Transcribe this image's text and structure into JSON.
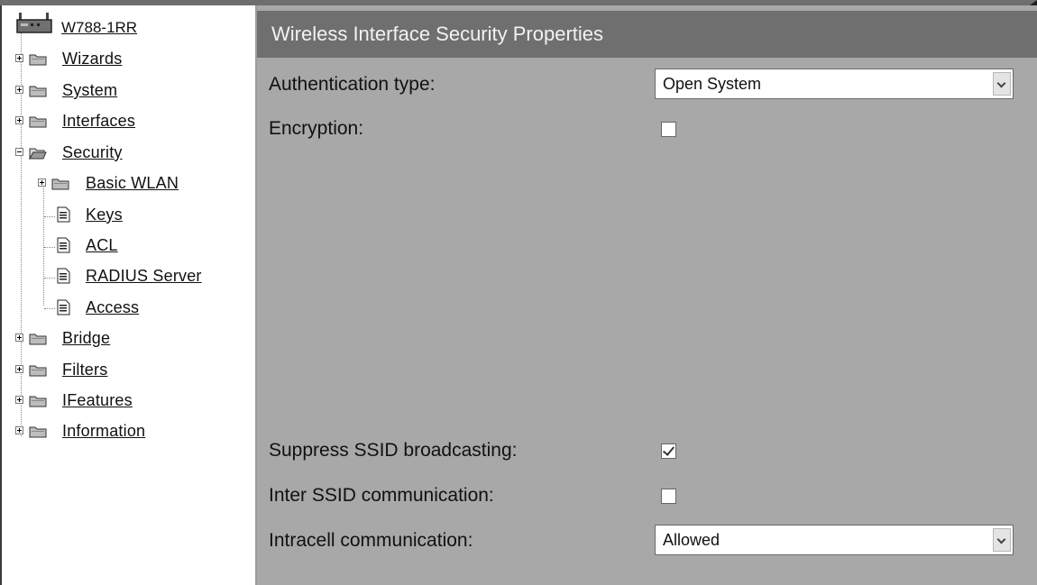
{
  "tree": {
    "root": "W788-1RR",
    "items": [
      {
        "label": "Wizards"
      },
      {
        "label": "System"
      },
      {
        "label": "Interfaces"
      },
      {
        "label": "Security"
      },
      {
        "label": "Basic WLAN"
      },
      {
        "label": "Keys"
      },
      {
        "label": "ACL"
      },
      {
        "label": "RADIUS Server"
      },
      {
        "label": "Access"
      },
      {
        "label": "Bridge"
      },
      {
        "label": "Filters"
      },
      {
        "label": "IFeatures"
      },
      {
        "label": "Information"
      }
    ]
  },
  "panel": {
    "title": "Wireless Interface Security Properties",
    "auth_label": "Authentication type:",
    "auth_value": "Open System",
    "encryption_label": "Encryption:",
    "encryption_checked": false,
    "suppress_label": "Suppress SSID broadcasting:",
    "suppress_checked": true,
    "inter_label": "Inter SSID communication:",
    "inter_checked": false,
    "intracell_label": "Intracell communication:",
    "intracell_value": "Allowed"
  },
  "icons": {
    "device": "device-icon",
    "folder": "folder-icon",
    "folder_open": "folder-open-icon",
    "document": "document-icon",
    "expand": "plus-icon",
    "collapse": "minus-icon",
    "dropdown": "chevron-down-icon"
  }
}
